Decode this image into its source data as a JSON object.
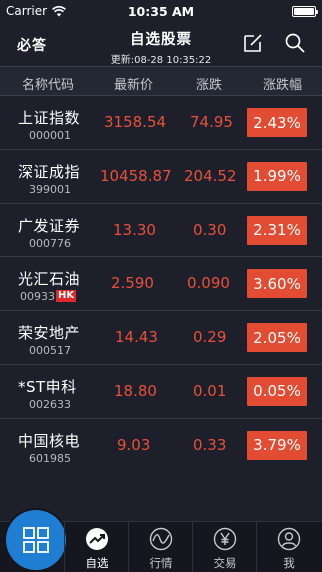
{
  "status_bar": {
    "carrier": "Carrier",
    "time": "10:35 AM",
    "battery_level": 1.0
  },
  "nav": {
    "brand": "必答",
    "title": "自选股票",
    "subtitle": "更新:08-28 10:35:22"
  },
  "columns": {
    "name": "名称代码",
    "price": "最新价",
    "change": "涨跌",
    "pct": "涨跌幅"
  },
  "stocks": [
    {
      "name": "上证指数",
      "code": "000001",
      "badge": "",
      "price": "3158.54",
      "change": "74.95",
      "pct": "2.43%"
    },
    {
      "name": "深证成指",
      "code": "399001",
      "badge": "",
      "price": "10458.87",
      "change": "204.52",
      "pct": "1.99%"
    },
    {
      "name": "广发证券",
      "code": "000776",
      "badge": "",
      "price": "13.30",
      "change": "0.30",
      "pct": "2.31%"
    },
    {
      "name": "光汇石油",
      "code": "00933",
      "badge": "HK",
      "price": "2.590",
      "change": "0.090",
      "pct": "3.60%"
    },
    {
      "name": "荣安地产",
      "code": "000517",
      "badge": "",
      "price": "14.43",
      "change": "0.29",
      "pct": "2.05%"
    },
    {
      "name": "*ST申科",
      "code": "002633",
      "badge": "",
      "price": "18.80",
      "change": "0.01",
      "pct": "0.05%"
    },
    {
      "name": "中国核电",
      "code": "601985",
      "badge": "",
      "price": "9.03",
      "change": "0.33",
      "pct": "3.79%"
    }
  ],
  "tabs": [
    {
      "label": "自选",
      "icon": "trend-icon"
    },
    {
      "label": "行情",
      "icon": "wave-icon"
    },
    {
      "label": "交易",
      "icon": "yen-icon"
    },
    {
      "label": "我",
      "icon": "user-icon"
    }
  ],
  "colors": {
    "up": "#e8503a",
    "pct_bg": "#e24c33",
    "fab": "#1f7ed2",
    "bg": "#1d1f2a"
  }
}
